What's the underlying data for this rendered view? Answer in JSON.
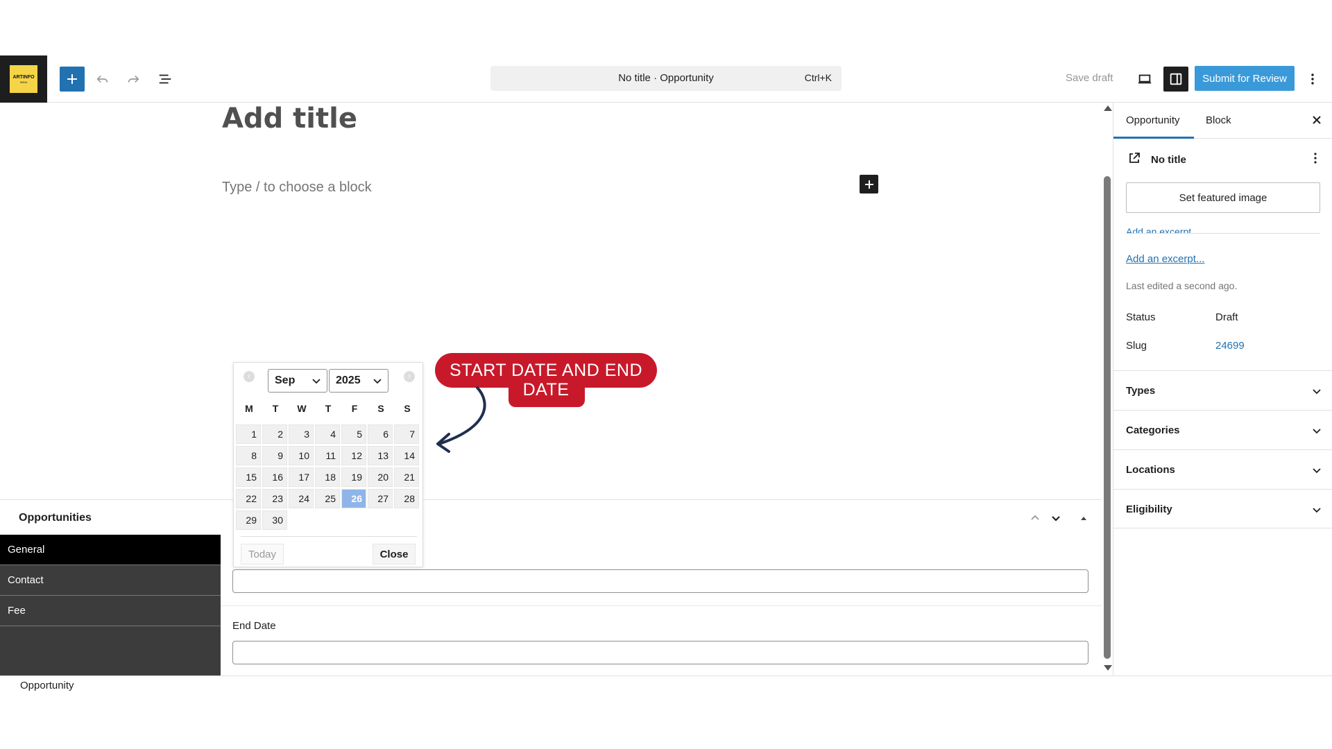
{
  "topbar": {
    "logo_text": "ARTINFO",
    "logo_sub": "INDIA",
    "command_title": "No title · Opportunity",
    "command_shortcut": "Ctrl+K",
    "save_draft": "Save draft",
    "submit": "Submit for Review",
    "accent": "#2271b1"
  },
  "editor": {
    "title_placeholder": "Add title",
    "block_placeholder": "Type / to choose a block"
  },
  "metabox": {
    "title": "Opportunities",
    "tabs": [
      "General",
      "Contact",
      "Fee"
    ],
    "active_tab": "General",
    "end_date_label": "End Date",
    "footer_crumb": "Opportunity"
  },
  "datepicker": {
    "month": "Sep",
    "year": "2025",
    "day_names": [
      "M",
      "T",
      "W",
      "T",
      "F",
      "S",
      "S"
    ],
    "weeks": [
      [
        "1",
        "2",
        "3",
        "4",
        "5",
        "6",
        "7"
      ],
      [
        "8",
        "9",
        "10",
        "11",
        "12",
        "13",
        "14"
      ],
      [
        "15",
        "16",
        "17",
        "18",
        "19",
        "20",
        "21"
      ],
      [
        "22",
        "23",
        "24",
        "25",
        "26",
        "27",
        "28"
      ],
      [
        "29",
        "30"
      ]
    ],
    "selected_day": "26",
    "today_label": "Today",
    "close_label": "Close"
  },
  "callout": {
    "text": "START DATE AND END DATE",
    "color": "#c8192a"
  },
  "sidebar": {
    "tabs": [
      "Opportunity",
      "Block"
    ],
    "post_title": "No title",
    "featured_image": "Set featured image",
    "excerpt_clipped": "Add an excerpt",
    "excerpt_link": "Add an excerpt...",
    "last_edited": "Last edited a second ago.",
    "status_label": "Status",
    "status_value": "Draft",
    "slug_label": "Slug",
    "slug_value": "24699",
    "panels": [
      "Types",
      "Categories",
      "Locations",
      "Eligibility"
    ]
  }
}
